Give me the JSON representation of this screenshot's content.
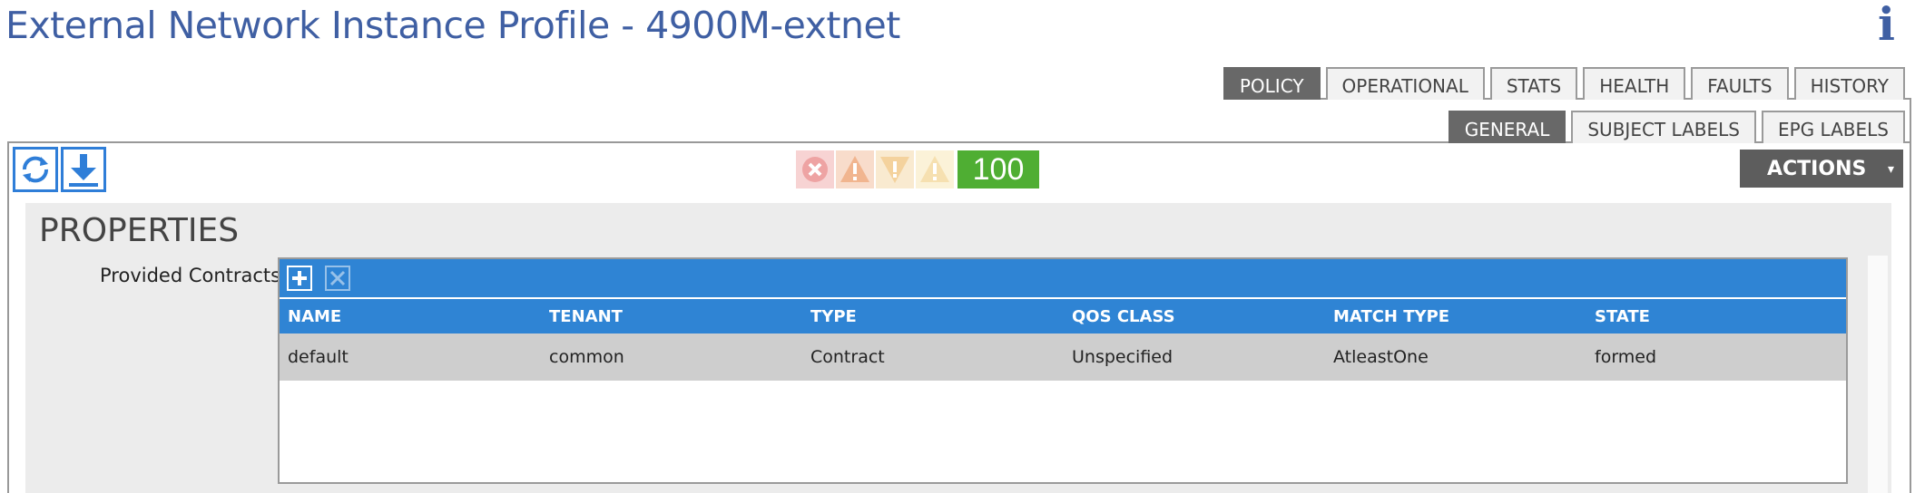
{
  "page": {
    "title": "External Network Instance Profile - 4900M-extnet",
    "info_icon": "info-icon"
  },
  "main_tabs": [
    {
      "label": "POLICY",
      "active": true
    },
    {
      "label": "OPERATIONAL",
      "active": false
    },
    {
      "label": "STATS",
      "active": false
    },
    {
      "label": "HEALTH",
      "active": false
    },
    {
      "label": "FAULTS",
      "active": false
    },
    {
      "label": "HISTORY",
      "active": false
    }
  ],
  "sub_tabs": [
    {
      "label": "GENERAL",
      "active": true
    },
    {
      "label": "SUBJECT LABELS",
      "active": false
    },
    {
      "label": "EPG LABELS",
      "active": false
    }
  ],
  "toolbar": {
    "refresh_icon": "refresh-icon",
    "download_icon": "download-icon"
  },
  "health": {
    "fault_icons": [
      "critical-fault-icon",
      "major-fault-icon",
      "minor-fault-icon",
      "warning-fault-icon"
    ],
    "score": "100",
    "score_color": "#4fae33"
  },
  "actions": {
    "label": "ACTIONS",
    "caret": "▾"
  },
  "properties": {
    "heading": "PROPERTIES",
    "provided_contracts": {
      "label": "Provided Contracts:",
      "columns": [
        "NAME",
        "TENANT",
        "TYPE",
        "QOS CLASS",
        "MATCH TYPE",
        "STATE"
      ],
      "rows": [
        [
          "default",
          "common",
          "Contract",
          "Unspecified",
          "AtleastOne",
          "formed"
        ]
      ]
    }
  },
  "colors": {
    "title": "#3f5fa3",
    "grid_header": "#2f84d4",
    "active_tab": "#686868"
  }
}
